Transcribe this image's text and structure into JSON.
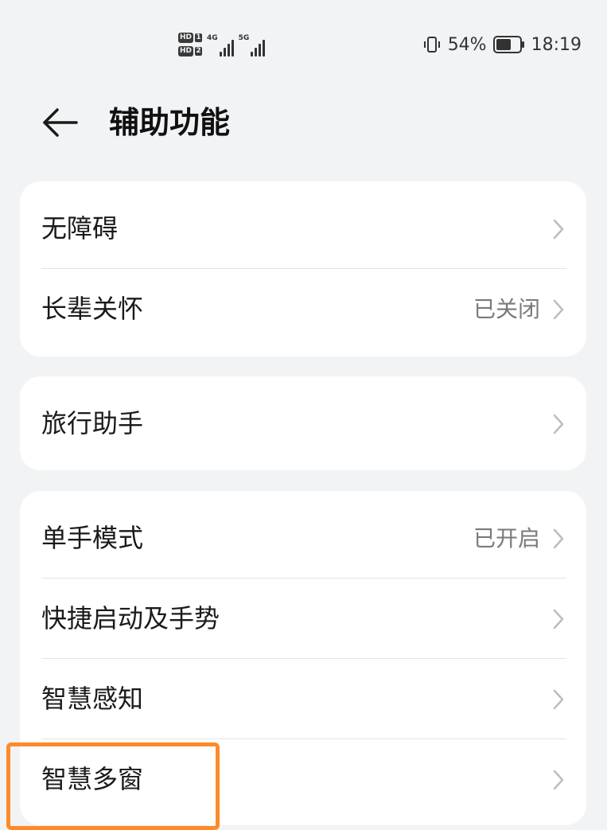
{
  "status_bar": {
    "sim1_label": "HD",
    "sim1_num": "1",
    "sim2_label": "HD",
    "sim2_num": "2",
    "net1_label": "4G",
    "net2_label": "5G",
    "battery_percent": "54%",
    "time": "18:19",
    "icons": [
      "vibrate-icon",
      "battery-icon",
      "signal-icon"
    ]
  },
  "header": {
    "title": "辅助功能",
    "back_icon": "back-arrow-icon"
  },
  "groups": [
    {
      "items": [
        {
          "label": "无障碍",
          "status": ""
        },
        {
          "label": "长辈关怀",
          "status": "已关闭"
        }
      ]
    },
    {
      "items": [
        {
          "label": "旅行助手",
          "status": ""
        }
      ]
    },
    {
      "items": [
        {
          "label": "单手模式",
          "status": "已开启"
        },
        {
          "label": "快捷启动及手势",
          "status": ""
        },
        {
          "label": "智慧感知",
          "status": ""
        },
        {
          "label": "智慧多窗",
          "status": ""
        }
      ]
    }
  ],
  "colors": {
    "background": "#f1f3f5",
    "card": "#ffffff",
    "highlight": "#ff8a2a",
    "secondary_text": "#7a7a7a"
  }
}
